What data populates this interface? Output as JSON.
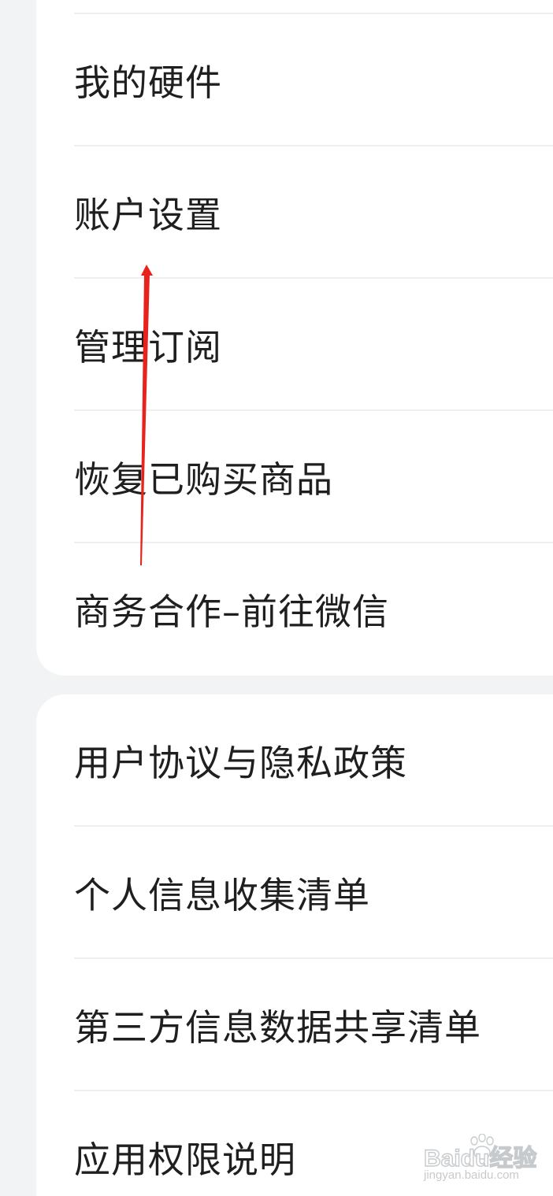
{
  "group_one": {
    "items": [
      {
        "label": "我的硬件"
      },
      {
        "label": "账户设置"
      },
      {
        "label": "管理订阅"
      },
      {
        "label": "恢复已购买商品"
      },
      {
        "label": "商务合作–前往微信"
      }
    ]
  },
  "group_two": {
    "items": [
      {
        "label": "用户协议与隐私政策"
      },
      {
        "label": "个人信息收集清单"
      },
      {
        "label": "第三方信息数据共享清单"
      },
      {
        "label": "应用权限说明"
      }
    ]
  },
  "watermark": {
    "brand": "Baidu经验",
    "sub": "jingyan.baidu.com"
  },
  "colors": {
    "background": "#f2f3f5",
    "card": "#ffffff",
    "text": "#1f1f1f",
    "annotation_arrow": "#e8231e"
  }
}
